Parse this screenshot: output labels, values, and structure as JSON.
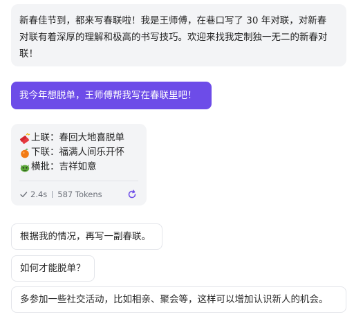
{
  "intro": {
    "line1": "新春佳节到，都来写春联啦！我是王师傅，在巷口写了 30 年对联，对新春",
    "line2": "对联有着深厚的理解和极高的书写技巧。欢迎来找我定制独一无二的新春对",
    "line3": "联！"
  },
  "user_message": "我今年想脱单，王师傅帮我写在春联里吧！",
  "couplet": {
    "upper_label": "上联：",
    "upper_text": "春回大地喜脱单",
    "lower_label": "下联：",
    "lower_text": "福满人间乐开怀",
    "banner_label": "横批：",
    "banner_text": "吉祥如意",
    "icons": [
      "firecracker-icon",
      "tangerine-icon",
      "dragon-icon"
    ]
  },
  "meta": {
    "time": "2.4s",
    "tokens": "587 Tokens"
  },
  "suggestions": [
    "根据我的情况，再写一副春联。",
    "如何才能脱单？",
    "多参加一些社交活动，比如相亲、聚会等，这样可以增加认识新人的机会。"
  ],
  "colors": {
    "accent": "#6d4ce8",
    "bot_bubble": "#f3f4f6",
    "border": "#e3e5ea"
  }
}
